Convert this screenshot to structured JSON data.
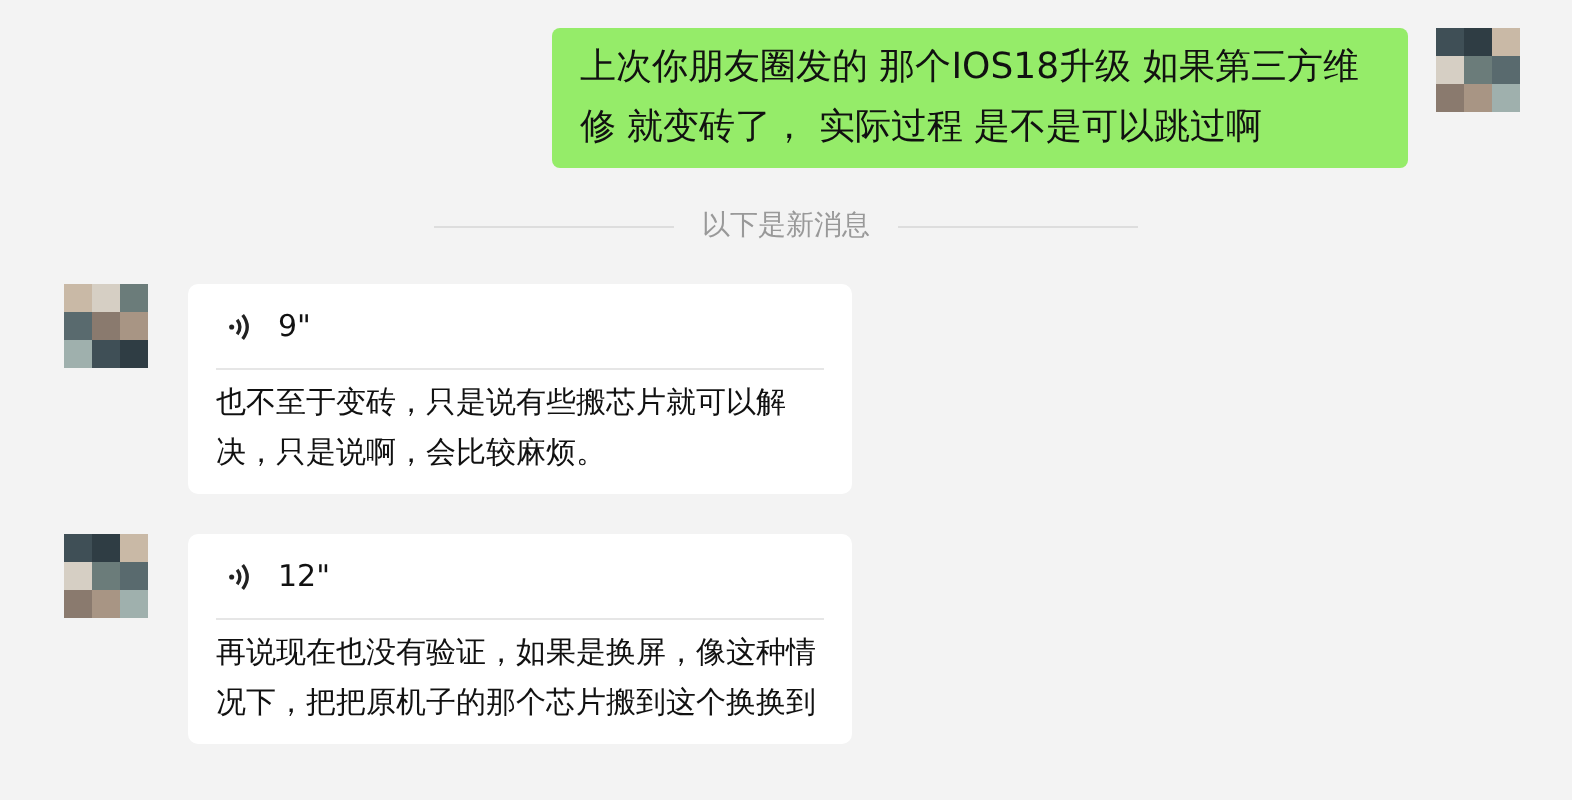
{
  "messages": [
    {
      "kind": "text",
      "outgoing": true,
      "text": "上次你朋友圈发的 那个IOS18升级 如果第三方维修 就变砖了，  实际过程 是不是可以跳过啊"
    },
    {
      "kind": "divider",
      "text": "以下是新消息"
    },
    {
      "kind": "voice",
      "outgoing": false,
      "duration": "9\"",
      "transcript": "也不至于变砖，只是说有些搬芯片就可以解决，只是说啊，会比较麻烦。"
    },
    {
      "kind": "voice",
      "outgoing": false,
      "duration": "12\"",
      "transcript": "再说现在也没有验证，如果是换屏，像这种情况下，把把原机子的那个芯片搬到这个换换到"
    }
  ]
}
